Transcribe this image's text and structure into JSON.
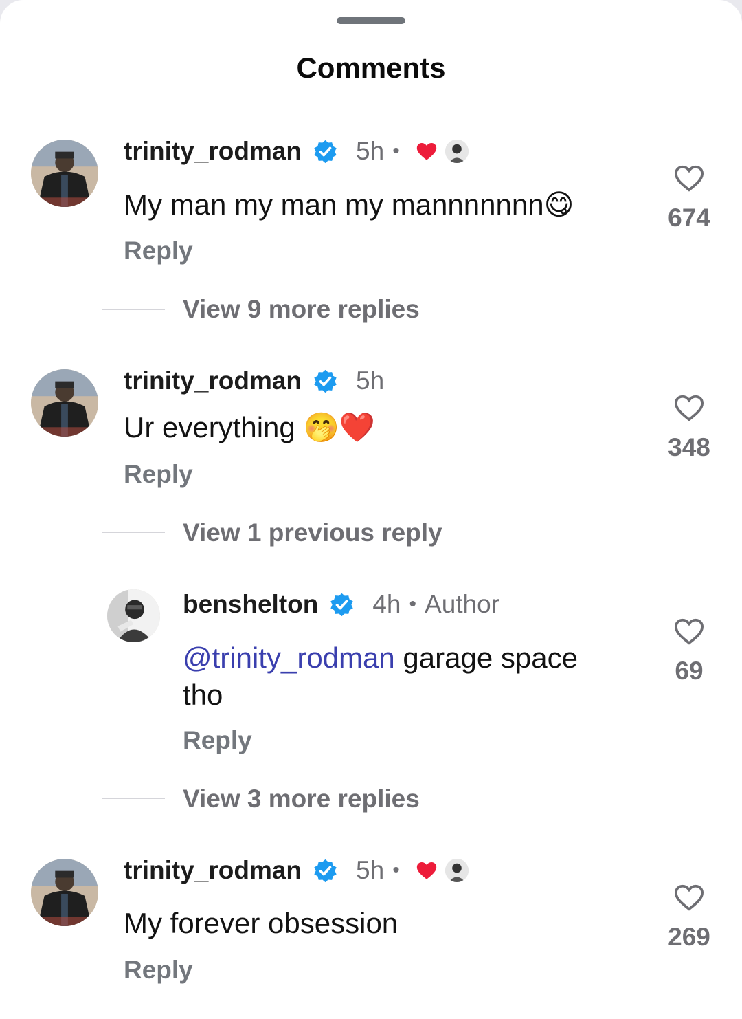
{
  "sheet": {
    "title": "Comments"
  },
  "colors": {
    "verified": "#1d9bf0",
    "heart_red": "#ed1c3a",
    "mention": "#3a3fae",
    "muted": "#6e6e73"
  },
  "comments": [
    {
      "username": "trinity_rodman",
      "verified": true,
      "time": "5h",
      "separator": "•",
      "author_liked": true,
      "text": "My man my man my mannnnnnn",
      "emoji": "😋",
      "reply_label": "Reply",
      "likes": "674",
      "view_more": "View 9 more replies"
    },
    {
      "username": "trinity_rodman",
      "verified": true,
      "time": "5h",
      "text": "Ur everything ",
      "emoji": "🤭❤️",
      "reply_label": "Reply",
      "likes": "348",
      "view_previous": "View 1 previous reply",
      "replies": [
        {
          "username": "benshelton",
          "verified": true,
          "time": "4h",
          "separator": "•",
          "badge": "Author",
          "mention": "@trinity_rodman",
          "text": " garage space tho",
          "reply_label": "Reply",
          "likes": "69"
        }
      ],
      "view_more": "View 3 more replies"
    },
    {
      "username": "trinity_rodman",
      "verified": true,
      "time": "5h",
      "separator": "•",
      "author_liked": true,
      "text": "My forever obsession",
      "reply_label": "Reply",
      "likes": "269"
    }
  ]
}
